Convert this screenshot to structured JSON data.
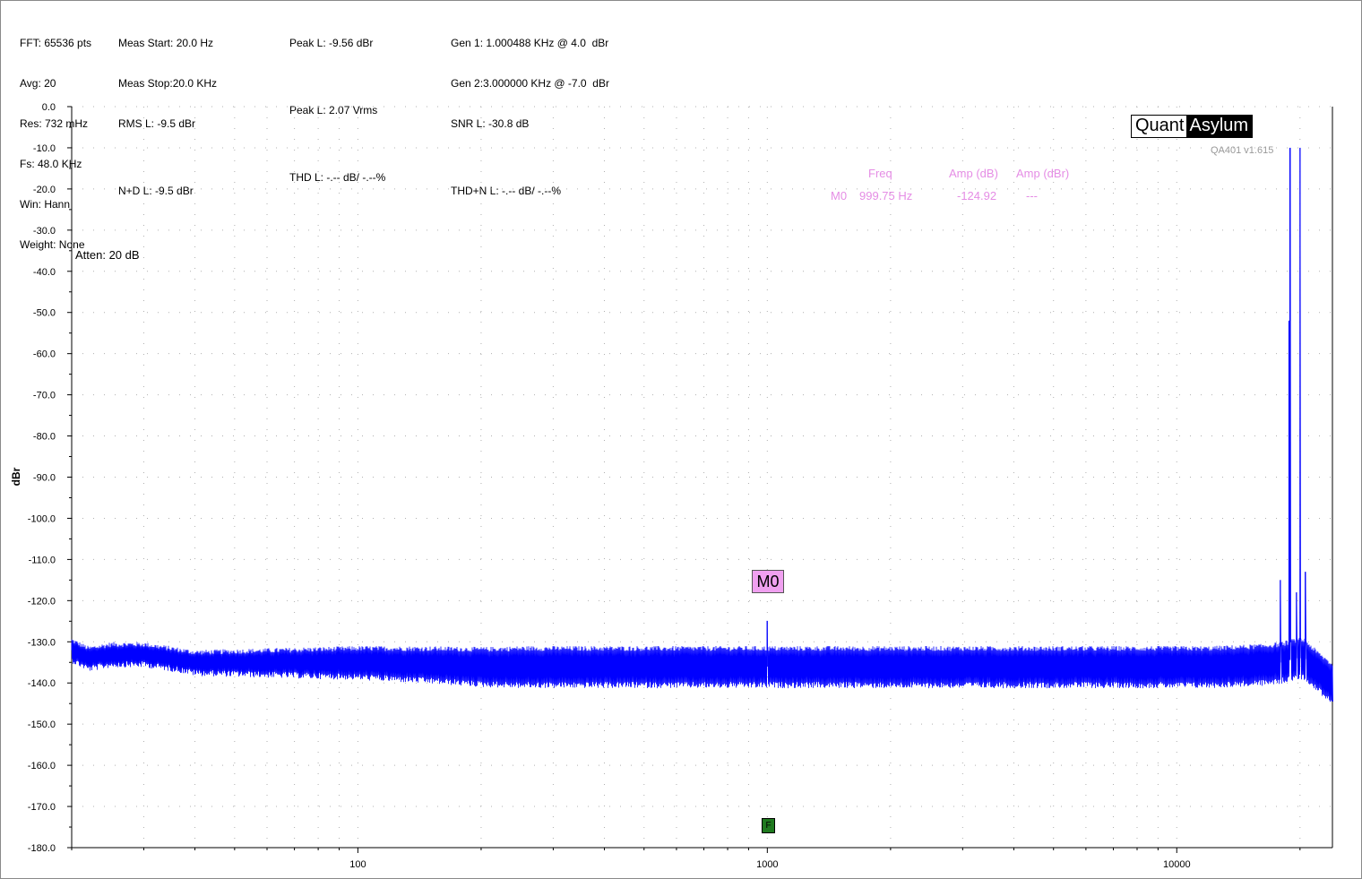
{
  "header": {
    "c1": [
      "FFT: 65536 pts",
      "Avg: 20",
      "Res: 732 mHz",
      "Fs: 48.0 KHz",
      "Win: Hann",
      "Weight: None"
    ],
    "c2": [
      "Meas Start: 20.0 Hz",
      "Meas Stop:20.0 KHz",
      "RMS L: -9.5 dBr",
      "",
      "N+D L: -9.5 dBr"
    ],
    "c3": [
      "Peak L: -9.56 dBr",
      "",
      "Peak L: 2.07 Vrms",
      "",
      "THD L: -.-- dB/ -.--%"
    ],
    "c4": [
      "Gen 1: 1.000488 KHz @ 4.0  dBr",
      "Gen 2:3.000000 KHz @ -7.0  dBr",
      "SNR L: -30.8 dB",
      "",
      "THD+N L: -.-- dB/ -.--%"
    ]
  },
  "logo": {
    "left": "Quant",
    "right": "Asylum",
    "version": "QA401 v1.615"
  },
  "marker_table": {
    "headers": [
      "Freq",
      "Amp (dB)",
      "Amp (dBr)"
    ],
    "row": {
      "name": "M0",
      "freq": "999.75 Hz",
      "amp_db": "-124.92",
      "amp_dbr": "---"
    }
  },
  "annotations": {
    "atten": "Atten: 20 dB",
    "marker_label": "M0",
    "f_marker": "F"
  },
  "colors": {
    "trace": "#0000ff",
    "marker_text": "#e58de5",
    "marker_box": "#f0a0f0",
    "grid": "#b0b0b0"
  },
  "chart_data": {
    "type": "line",
    "xscale": "log",
    "xlim": [
      20,
      24000
    ],
    "ylim": [
      -180,
      0
    ],
    "ylabel": "dBr",
    "xlabel": "",
    "y_ticks": [
      0,
      -10,
      -20,
      -30,
      -40,
      -50,
      -60,
      -70,
      -80,
      -90,
      -100,
      -110,
      -120,
      -130,
      -140,
      -150,
      -160,
      -170,
      -180
    ],
    "x_tick_labels": [
      {
        "value": 100,
        "label": "100"
      },
      {
        "value": 1000,
        "label": "1000"
      },
      {
        "value": 10000,
        "label": "10000"
      }
    ],
    "grid": true,
    "series": [
      {
        "noise_floor_points": [
          [
            20,
            -132
          ],
          [
            22,
            -134
          ],
          [
            25,
            -133
          ],
          [
            30,
            -133
          ],
          [
            35,
            -134
          ],
          [
            40,
            -135
          ],
          [
            50,
            -135
          ],
          [
            70,
            -135
          ],
          [
            100,
            -135
          ],
          [
            150,
            -135.5
          ],
          [
            200,
            -136
          ],
          [
            400,
            -136
          ],
          [
            700,
            -136
          ],
          [
            1000,
            -136
          ],
          [
            2000,
            -136
          ],
          [
            4000,
            -136
          ],
          [
            8000,
            -136
          ],
          [
            12000,
            -136
          ],
          [
            16000,
            -135.5
          ],
          [
            18000,
            -135
          ],
          [
            19500,
            -134
          ],
          [
            20500,
            -134
          ],
          [
            21000,
            -135
          ],
          [
            22000,
            -137
          ],
          [
            23000,
            -138.5
          ],
          [
            24000,
            -140
          ]
        ],
        "peaks": [
          {
            "x": 999.75,
            "y": -124.92
          },
          {
            "x": 17900,
            "y": -115
          },
          {
            "x": 18800,
            "y": -52
          },
          {
            "x": 18900,
            "y": -10
          },
          {
            "x": 19600,
            "y": -118
          },
          {
            "x": 20000,
            "y": -10
          },
          {
            "x": 20600,
            "y": -113
          }
        ]
      }
    ]
  }
}
